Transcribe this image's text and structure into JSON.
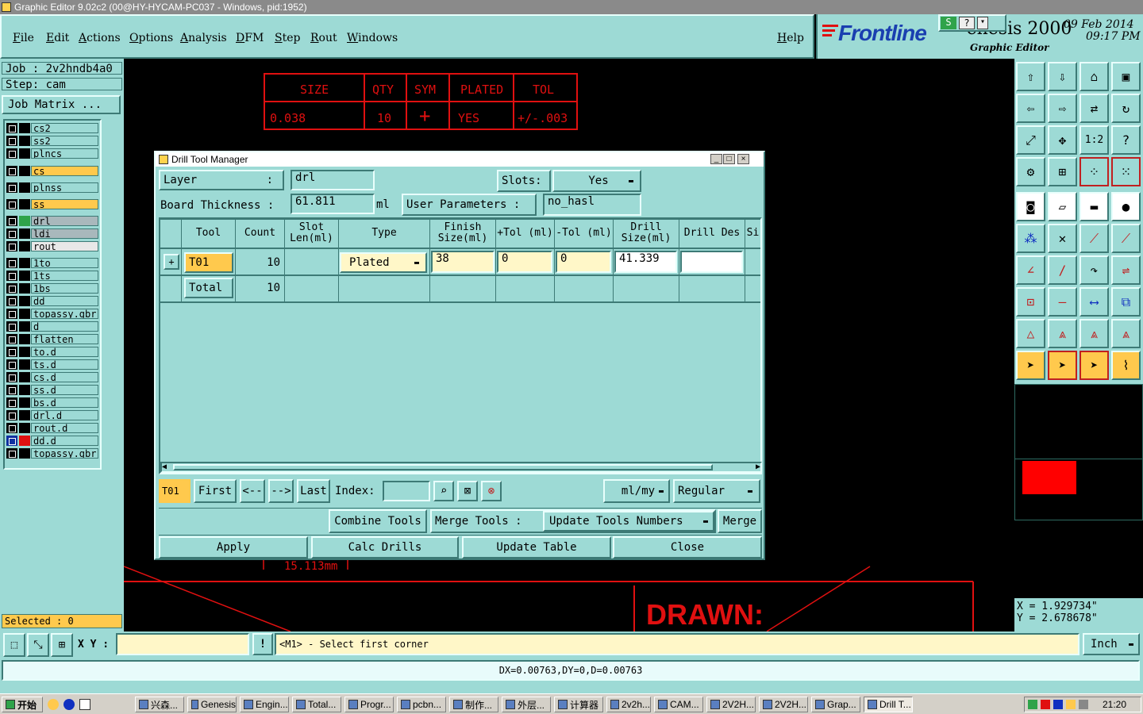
{
  "window": {
    "title": "Graphic Editor 9.02c2 (00@HY-HYCAM-PC037 - Windows, pid:1952)"
  },
  "menu": [
    "File",
    "Edit",
    "Actions",
    "Options",
    "Analysis",
    "DFM",
    "Step",
    "Rout",
    "Windows"
  ],
  "help": "Help",
  "logo": {
    "brand": "Frontline",
    "product": "Genesis 2000",
    "subtitle": "Graphic Editor",
    "date": "09 Feb 2014",
    "time": "09:17 PM"
  },
  "job": {
    "job": "Job : 2v2hndb4a0",
    "step": "Step: cam",
    "matrix": "Job Matrix ..."
  },
  "layers": {
    "group1": [
      "cs2",
      "ss2",
      "plncs"
    ],
    "cs": "cs",
    "plnss": "plnss",
    "ss": "ss",
    "group2": [
      "drl",
      "ldi",
      "rout"
    ],
    "group3": [
      "1to",
      "1ts",
      "1bs",
      "dd",
      "topassy.gbr",
      "d",
      "flatten",
      "to.d",
      "ts.d",
      "cs.d",
      "ss.d",
      "bs.d",
      "drl.d",
      "rout.d",
      "dd.d",
      "topassy.gbr"
    ]
  },
  "selected": "Selected : 0",
  "canvas": {
    "table": {
      "headers": [
        "SIZE",
        "QTY",
        "SYM",
        "PLATED",
        "TOL"
      ],
      "row": [
        "0.038",
        "10",
        "+",
        "YES",
        "+/-.003"
      ]
    },
    "dim": "15.113mm",
    "drawn": "DRAWN:"
  },
  "coords": {
    "x": "X = 1.929734\"",
    "y": "Y = 2.678678\""
  },
  "dialog": {
    "title": "Drill Tool Manager",
    "layer_label": "Layer",
    "layer_value": "drl",
    "slots_label": "Slots:",
    "slots_value": "Yes",
    "thickness_label": "Board Thickness :",
    "thickness_value": "61.811",
    "thickness_unit": "ml",
    "user_params_label": "User Parameters :",
    "user_params_value": "no_hasl",
    "columns": [
      "Tool",
      "Count",
      "Slot Len(ml)",
      "Type",
      "Finish Size(ml)",
      "+Tol (ml)",
      "-Tol (ml)",
      "Drill Size(ml)",
      "Drill Des",
      "Si"
    ],
    "row": {
      "tool": "T01",
      "count": "10",
      "type": "Plated",
      "finish": "38",
      "ptol": "0",
      "ntol": "0",
      "drill": "41.339",
      "des": ""
    },
    "total": {
      "label": "Total",
      "count": "10"
    },
    "nav": {
      "current": "T01",
      "first": "First",
      "prev": "<--",
      "next": "-->",
      "last": "Last",
      "index_label": "Index:",
      "units": "ml/my",
      "mode": "Regular"
    },
    "row2": {
      "combine": "Combine Tools",
      "merge_tools": "Merge Tools :",
      "update_numbers": "Update Tools Numbers",
      "merge": "Merge"
    },
    "actions": {
      "apply": "Apply",
      "calc": "Calc Drills",
      "update": "Update Table",
      "close": "Close"
    }
  },
  "cmd": {
    "xy_label": "X Y :",
    "prompt": "<M1> - Select first corner",
    "units": "Inch"
  },
  "status": "DX=0.00763,DY=0,D=0.00763",
  "taskbar": {
    "start": "开始",
    "tasks": [
      "兴森...",
      "Genesis",
      "Engin...",
      "Total...",
      "Progr...",
      "pcbn...",
      "制作...",
      "外层...",
      "计算器",
      "2v2h...",
      "CAM...",
      "2V2H...",
      "2V2H...",
      "Grap...",
      "Drill T..."
    ],
    "clock": "21:20"
  }
}
